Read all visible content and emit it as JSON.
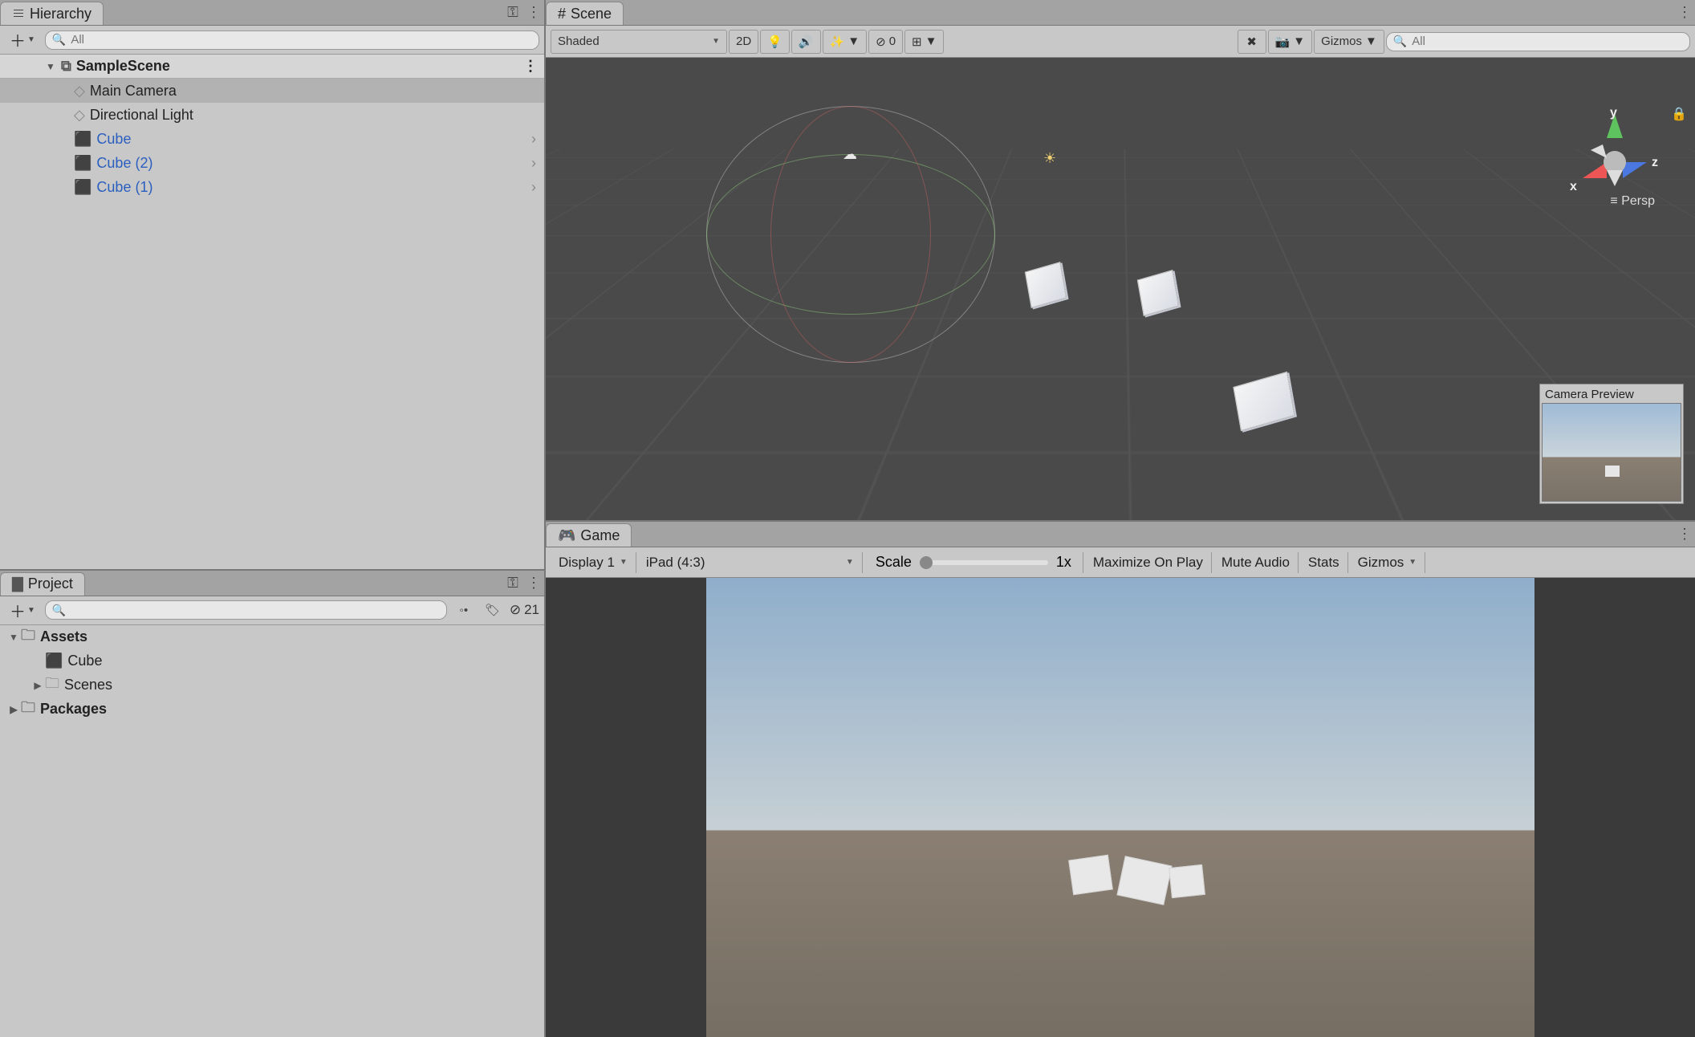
{
  "hierarchy": {
    "title": "Hierarchy",
    "search_placeholder": "All",
    "scene": {
      "name": "SampleScene"
    },
    "items": [
      {
        "name": "Main Camera",
        "icon": "gameobject",
        "prefab": false,
        "children": false,
        "selected": true
      },
      {
        "name": "Directional Light",
        "icon": "gameobject",
        "prefab": false,
        "children": false,
        "selected": false
      },
      {
        "name": "Cube",
        "icon": "prefab",
        "prefab": true,
        "children": true,
        "selected": false
      },
      {
        "name": "Cube (2)",
        "icon": "prefab",
        "prefab": true,
        "children": true,
        "selected": false
      },
      {
        "name": "Cube (1)",
        "icon": "prefab",
        "prefab": true,
        "children": true,
        "selected": false
      }
    ]
  },
  "project": {
    "title": "Project",
    "search_placeholder": "",
    "hidden_count": "21",
    "tree": {
      "assets_label": "Assets",
      "assets_children": [
        {
          "name": "Cube",
          "icon": "prefab"
        },
        {
          "name": "Scenes",
          "icon": "folder"
        }
      ],
      "packages_label": "Packages"
    }
  },
  "scene": {
    "tab": "Scene",
    "shading_mode": "Shaded",
    "btn_2d": "2D",
    "layers_count": "0",
    "gizmos_label": "Gizmos",
    "search_placeholder": "All",
    "persp_label": "Persp",
    "camera_preview_label": "Camera Preview",
    "axes": {
      "x": "x",
      "y": "y",
      "z": "z"
    }
  },
  "game": {
    "tab": "Game",
    "display": "Display 1",
    "aspect": "iPad (4:3)",
    "scale_label": "Scale",
    "scale_value": "1x",
    "maximize": "Maximize On Play",
    "mute": "Mute Audio",
    "stats": "Stats",
    "gizmos": "Gizmos"
  }
}
